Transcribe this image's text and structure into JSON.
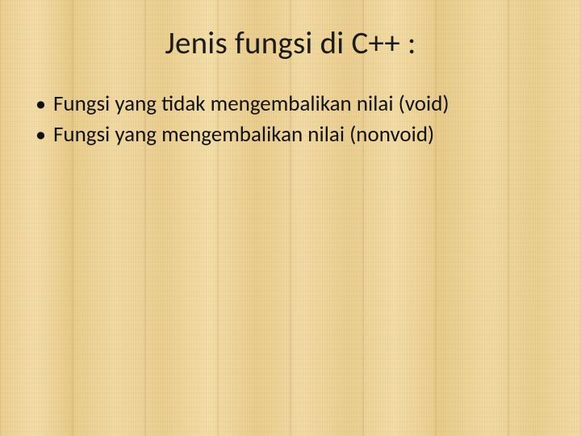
{
  "slide": {
    "title": "Jenis fungsi di C++ :",
    "bullets": [
      "Fungsi yang tidak mengembalikan nilai (void)",
      "Fungsi yang mengembalikan nilai (nonvoid)"
    ]
  }
}
